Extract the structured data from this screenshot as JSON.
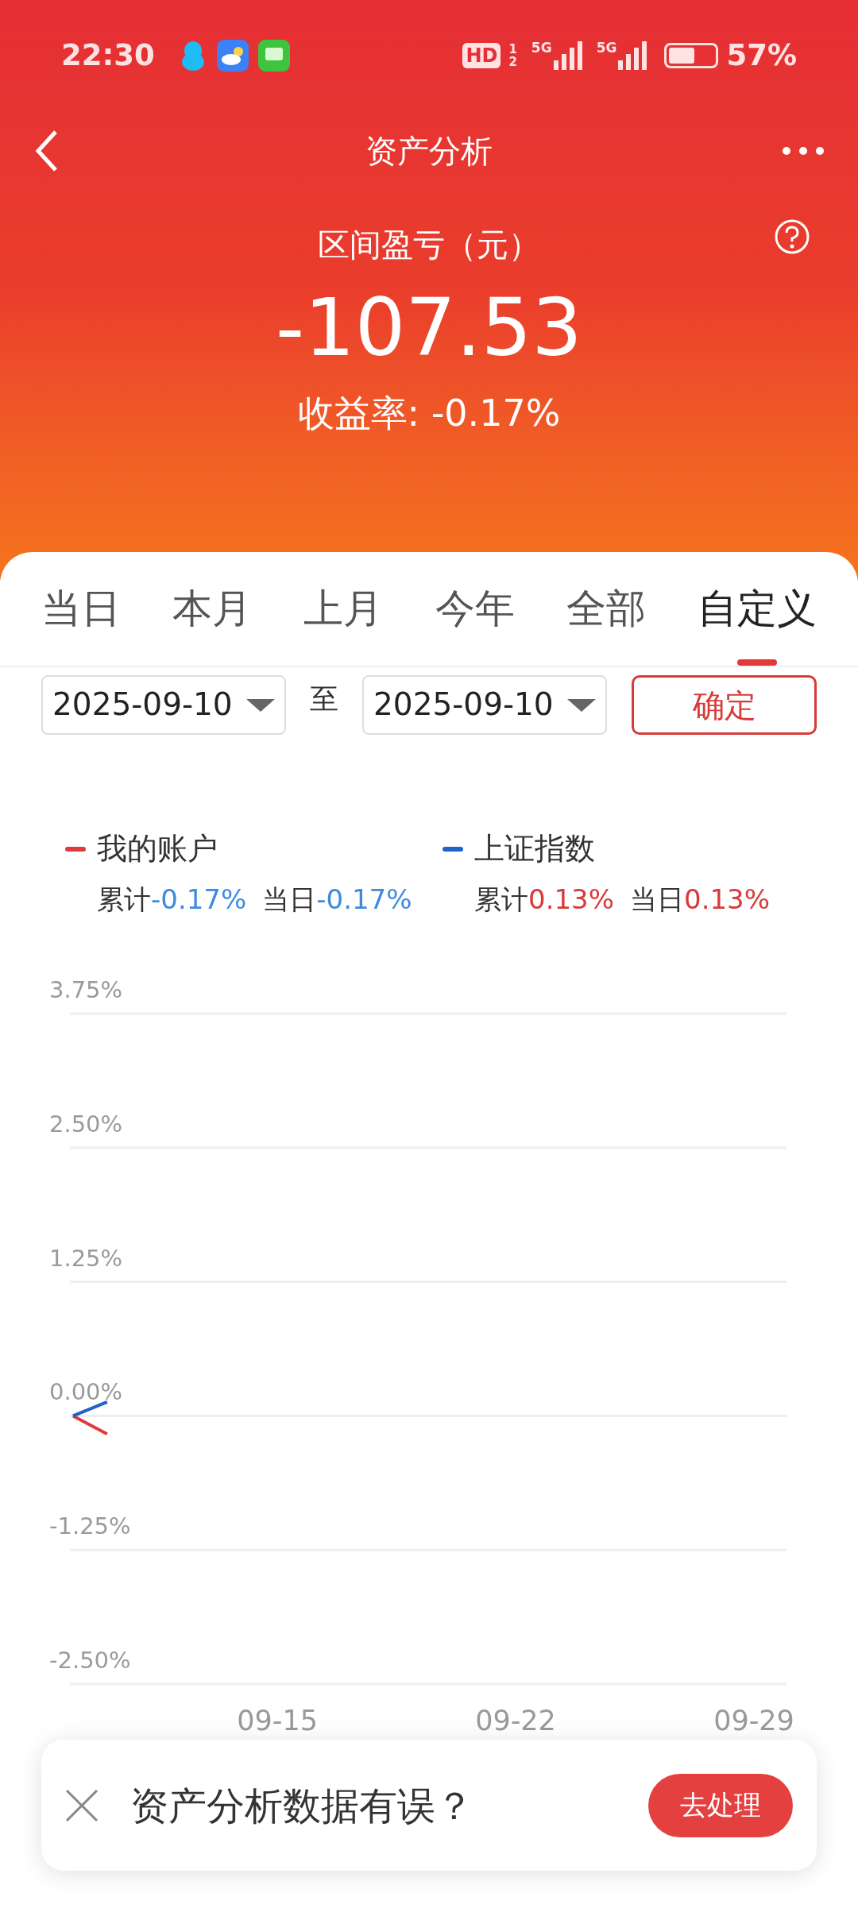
{
  "status_bar": {
    "time": "22:30",
    "hd": "HD",
    "sim_numbers": [
      "1",
      "2"
    ],
    "networks": [
      "5G",
      "5G"
    ],
    "battery": "57%"
  },
  "header": {
    "title": "资产分析"
  },
  "summary": {
    "label": "区间盈亏（元）",
    "value": "-107.53",
    "rate": "收益率: -0.17%"
  },
  "tabs": [
    {
      "label": "当日",
      "selected": false
    },
    {
      "label": "本月",
      "selected": false
    },
    {
      "label": "上月",
      "selected": false
    },
    {
      "label": "今年",
      "selected": false
    },
    {
      "label": "全部",
      "selected": false
    },
    {
      "label": "自定义",
      "selected": true
    }
  ],
  "date_range": {
    "from": "2025-09-10",
    "separator": "至",
    "to": "2025-09-10",
    "confirm": "确定"
  },
  "legend": [
    {
      "stats": [
        {
          "label": "累计",
          "value": "-0.17%",
          "color": "#3f8ae0"
        },
        {
          "label": "当日",
          "value": "-0.17%",
          "color": "#3f8ae0"
        }
      ]
    },
    {
      "stats": [
        {
          "label": "累计",
          "value": "0.13%",
          "color": "#d83a3a"
        },
        {
          "label": "当日",
          "value": "0.13%",
          "color": "#d83a3a"
        }
      ]
    }
  ],
  "chart_data": {
    "type": "line",
    "categories": [
      null,
      null,
      null,
      null,
      null,
      null,
      "09-15",
      null,
      null,
      null,
      null,
      null,
      null,
      "09-22",
      null,
      null,
      null,
      null,
      null,
      null,
      "09-29"
    ],
    "ylim": [
      -2.5,
      3.75
    ],
    "grid": true,
    "yticks": [
      {
        "value": 3.75,
        "label": "3.75%"
      },
      {
        "value": 2.5,
        "label": "2.50%"
      },
      {
        "value": 1.25,
        "label": "1.25%"
      },
      {
        "value": 0,
        "label": "0.00%"
      },
      {
        "value": -1.25,
        "label": "-1.25%"
      },
      {
        "value": -2.5,
        "label": "-2.50%"
      }
    ],
    "series": [
      {
        "name": "我的账户",
        "color": "#e03a3a",
        "values": [
          0,
          -0.17,
          null,
          null,
          null,
          null,
          null,
          null,
          null,
          null,
          null,
          null,
          null,
          null,
          null,
          null,
          null,
          null,
          null,
          null,
          null
        ]
      },
      {
        "name": "上证指数",
        "color": "#1f62c8",
        "values": [
          0,
          0.13,
          null,
          null,
          null,
          null,
          null,
          null,
          null,
          null,
          null,
          null,
          null,
          null,
          null,
          null,
          null,
          null,
          null,
          null,
          null
        ]
      }
    ]
  },
  "popup": {
    "message": "资产分析数据有误？",
    "action": "去处理"
  }
}
